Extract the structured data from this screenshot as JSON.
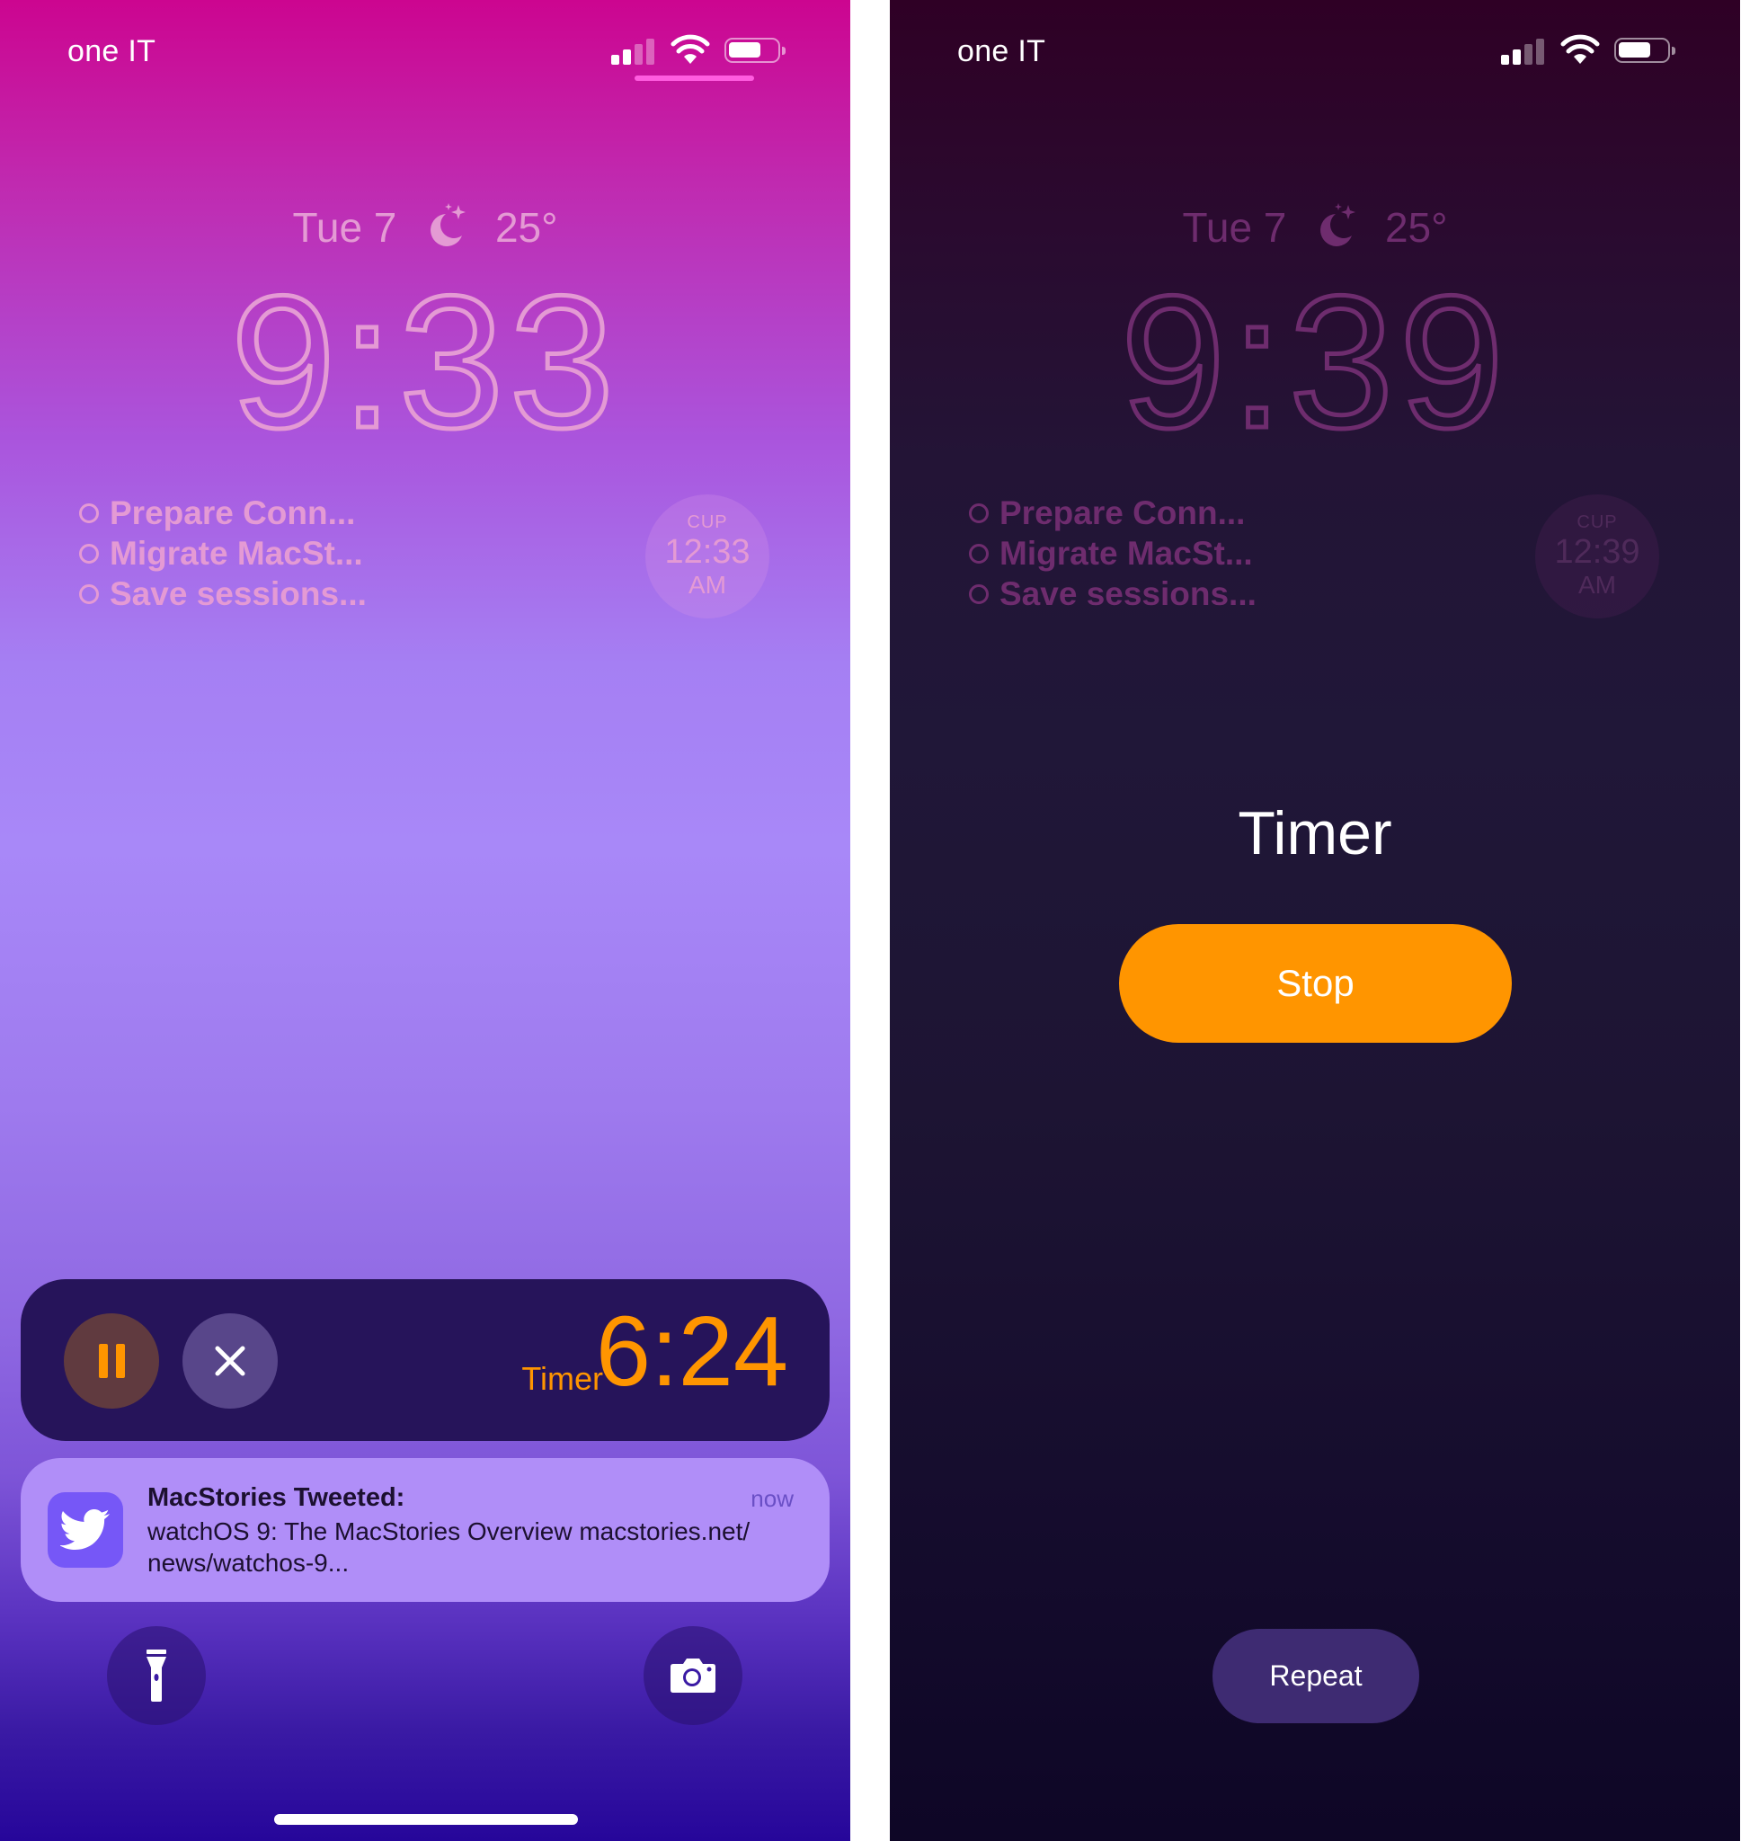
{
  "left": {
    "status_bar": {
      "carrier": "one IT",
      "signal_bars": 2,
      "signal_max": 4,
      "battery_fraction": 0.6
    },
    "lock": {
      "date": "Tue 7",
      "weather_icon": "moon-stars-icon",
      "temperature": "25°",
      "time": "9:33",
      "reminders": [
        "Prepare Conn...",
        "Migrate MacSt...",
        "Save sessions..."
      ],
      "world_clock": {
        "city": "CUP",
        "time": "12:33",
        "ampm": "AM"
      }
    },
    "live_activity": {
      "pause_icon": "pause-icon",
      "close_icon": "close-icon",
      "label": "Timer",
      "remaining": "6:24",
      "accent": "#FF9500"
    },
    "notification": {
      "app_icon": "twitter-bird-icon",
      "title": "MacStories Tweeted:",
      "time": "now",
      "body": "watchOS 9: The MacStories Overview macstories.net/ news/watchos-9..."
    },
    "quick_actions": {
      "left_icon": "flashlight-icon",
      "right_icon": "camera-icon"
    }
  },
  "right": {
    "status_bar": {
      "carrier": "one IT",
      "signal_bars": 2,
      "signal_max": 4,
      "battery_fraction": 0.6
    },
    "lock": {
      "date": "Tue 7",
      "weather_icon": "moon-stars-icon",
      "temperature": "25°",
      "time": "9:39",
      "reminders": [
        "Prepare Conn...",
        "Migrate MacSt...",
        "Save sessions..."
      ],
      "world_clock": {
        "city": "CUP",
        "time": "12:39",
        "ampm": "AM"
      }
    },
    "alert": {
      "title": "Timer",
      "stop_label": "Stop",
      "repeat_label": "Repeat",
      "accent": "#FF9500"
    }
  }
}
